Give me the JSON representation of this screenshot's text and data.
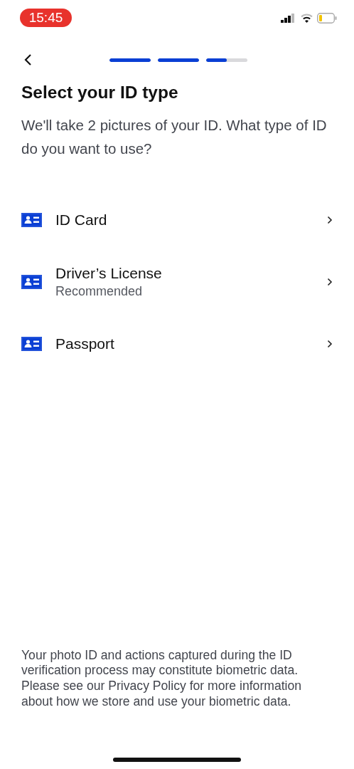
{
  "status_bar": {
    "time": "15:45"
  },
  "progress": [
    {
      "level": 1
    },
    {
      "level": 1
    },
    {
      "level": 0.5
    }
  ],
  "title": "Select your ID type",
  "subtitle": "We'll take 2 pictures of your ID. What type of ID do you want to use?",
  "options": [
    {
      "label": "ID Card"
    },
    {
      "label": "Driver’s License",
      "note": "Recommended"
    },
    {
      "label": "Passport"
    }
  ],
  "footer": "Your photo ID and actions captured during the ID verification process may constitute biometric data. Please see our Privacy Policy for more information about how we store and use your biometric data."
}
